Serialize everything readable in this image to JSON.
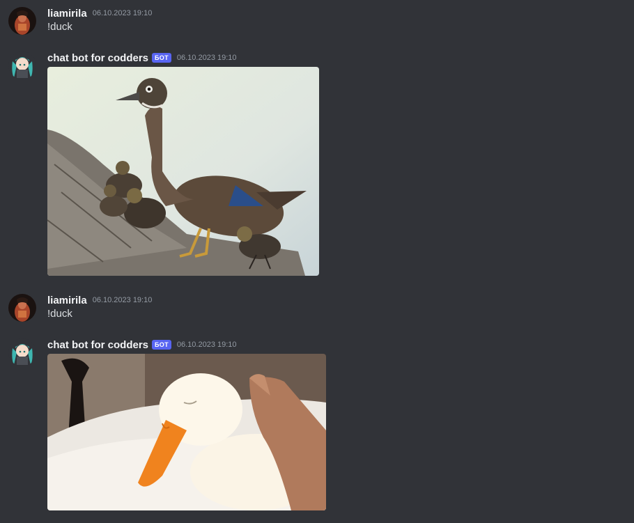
{
  "messages": [
    {
      "author": "liamirila",
      "timestamp": "06.10.2023 19:10",
      "text": "!duck",
      "avatar": "avatar-user"
    },
    {
      "author": "chat bot for codders",
      "badge": "БОТ",
      "timestamp": "06.10.2023 19:10",
      "attachment": "wood-duck-with-ducklings",
      "avatar": "avatar-bot"
    },
    {
      "author": "liamirila",
      "timestamp": "06.10.2023 19:10",
      "text": "!duck",
      "avatar": "avatar-user"
    },
    {
      "author": "chat bot for codders",
      "badge": "БОТ",
      "timestamp": "06.10.2023 19:10",
      "attachment": "white-duck-being-petted",
      "avatar": "avatar-bot"
    }
  ],
  "theme": {
    "background": "#313338",
    "badge": "#5865f2",
    "author": "#f2f3f5",
    "timestamp": "#949ba4",
    "text": "#dbdee1"
  }
}
